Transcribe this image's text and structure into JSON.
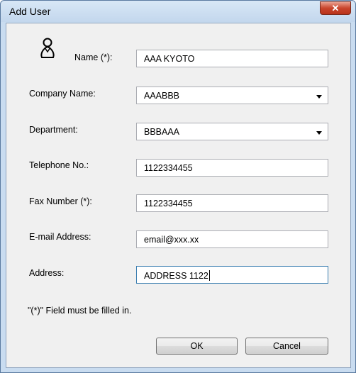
{
  "window": {
    "title": "Add User",
    "close_glyph": "✕"
  },
  "form": {
    "name_label": "Name (*):",
    "name_value": "AAA KYOTO",
    "company_label": "Company Name:",
    "company_value": "AAABBB",
    "department_label": "Department:",
    "department_value": "BBBAAA",
    "telephone_label": "Telephone No.:",
    "telephone_value": "1122334455",
    "fax_label": "Fax Number (*):",
    "fax_value": "1122334455",
    "email_label": "E-mail Address:",
    "email_value": "email@xxx.xx",
    "address_label": "Address:",
    "address_value": "ADDRESS 1122",
    "required_note": "\"(*)\" Field must be filled in."
  },
  "buttons": {
    "ok": "OK",
    "cancel": "Cancel"
  },
  "icons": {
    "user": "user-icon",
    "close": "close-icon",
    "dropdown": "chevron-down-icon"
  }
}
